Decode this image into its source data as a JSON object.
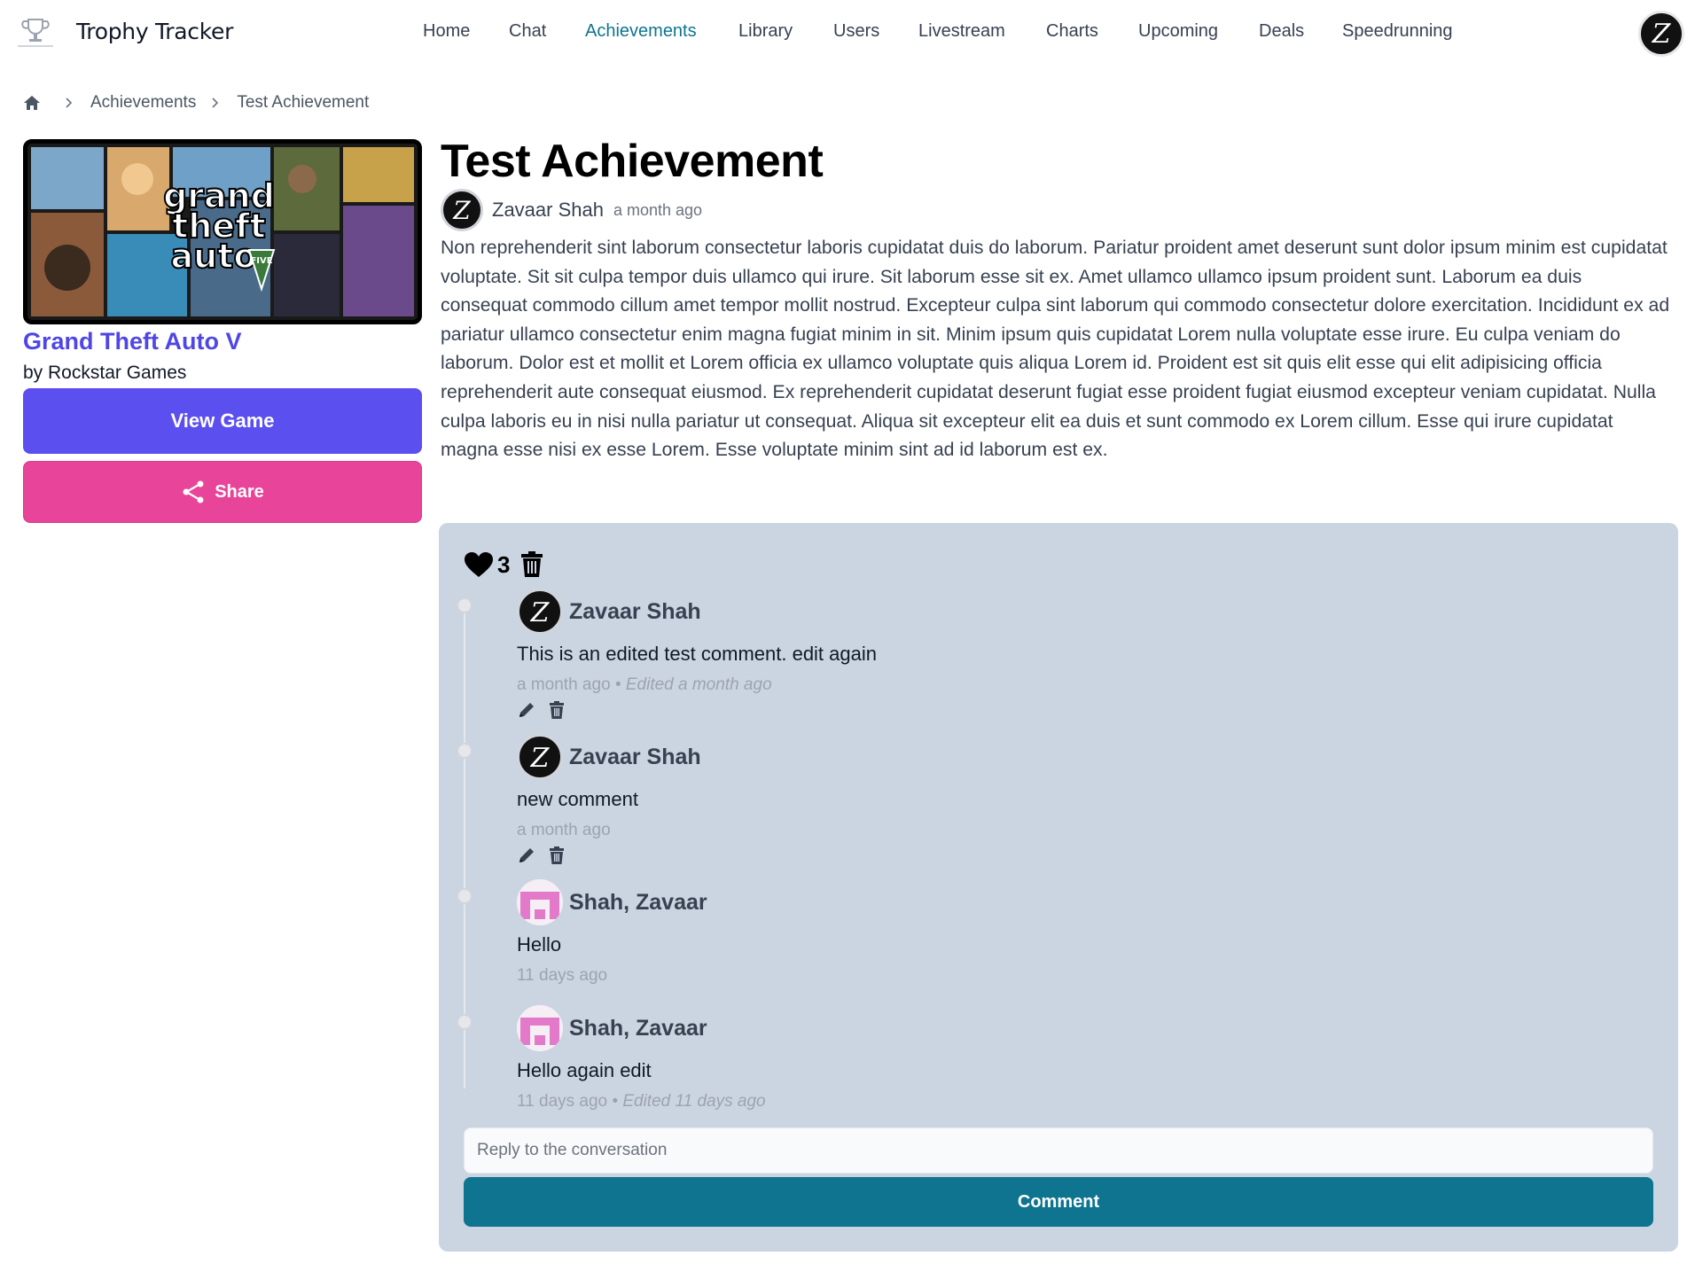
{
  "brand": {
    "name": "Trophy Tracker",
    "logo_icon": "trophy-tracker-logo-icon"
  },
  "nav": {
    "items": [
      {
        "label": "Home",
        "active": false
      },
      {
        "label": "Chat",
        "active": false
      },
      {
        "label": "Achievements",
        "active": true
      },
      {
        "label": "Library",
        "active": false
      },
      {
        "label": "Users",
        "active": false
      },
      {
        "label": "Livestream",
        "active": false
      },
      {
        "label": "Charts",
        "active": false
      },
      {
        "label": "Upcoming",
        "active": false
      },
      {
        "label": "Deals",
        "active": false
      },
      {
        "label": "Speedrunning",
        "active": false
      }
    ],
    "avatar_letter": "Z"
  },
  "breadcrumb": {
    "home_icon": "home-icon",
    "items": [
      "Achievements",
      "Test Achievement"
    ]
  },
  "game": {
    "cover_overlay_text": "grand theft auto",
    "cover_badge_text": "FIVE",
    "title": "Grand Theft Auto V",
    "developer": "by Rockstar Games",
    "view_label": "View Game",
    "share_label": "Share"
  },
  "achievement": {
    "title": "Test Achievement",
    "author": "Zavaar Shah",
    "author_avatar_letter": "Z",
    "posted": "a month ago",
    "description": "Non reprehenderit sint laborum consectetur laboris cupidatat duis do laborum. Pariatur proident amet deserunt sunt dolor ipsum minim est cupidatat voluptate. Sit sit culpa tempor duis ullamco qui irure. Sit laborum esse sit ex. Amet ullamco ullamco ipsum proident sunt. Laborum ea duis consequat commodo cillum amet tempor mollit nostrud. Excepteur culpa sint laborum qui commodo consectetur dolore exercitation. Incididunt ex ad pariatur ullamco consectetur enim magna fugiat minim in sit. Minim ipsum quis cupidatat Lorem nulla voluptate esse irure. Eu culpa veniam do laborum. Dolor est et mollit et Lorem officia ex ullamco voluptate quis aliqua Lorem id. Proident est sit quis elit esse qui elit adipisicing officia reprehenderit aute consequat eiusmod. Ex reprehenderit cupidatat deserunt fugiat esse proident fugiat eiusmod excepteur veniam cupidatat. Nulla culpa laboris eu in nisi nulla pariatur ut consequat. Aliqua sit excepteur elit ea duis et sunt commodo ex Lorem cillum. Esse qui irure cupidatat magna esse nisi ex esse Lorem. Esse voluptate minim sint ad id laborum est ex."
  },
  "reactions": {
    "like_count": "3",
    "like_icon": "heart-icon",
    "delete_icon": "trash-icon"
  },
  "comments": [
    {
      "author": "Zavaar Shah",
      "avatar": "letter-Z",
      "text": "This is an edited test comment. edit again",
      "time": "a month ago",
      "edited": "• Edited a month ago",
      "editable": true
    },
    {
      "author": "Zavaar Shah",
      "avatar": "letter-Z",
      "text": "new comment",
      "time": "a month ago",
      "edited": "",
      "editable": true
    },
    {
      "author": "Shah, Zavaar",
      "avatar": "pink-identicon",
      "text": "Hello",
      "time": "11 days ago",
      "edited": "",
      "editable": false
    },
    {
      "author": "Shah, Zavaar",
      "avatar": "pink-identicon",
      "text": "Hello again edit",
      "time": "11 days ago",
      "edited": "• Edited 11 days ago",
      "editable": false
    }
  ],
  "reply": {
    "placeholder": "Reply to the conversation",
    "value": "",
    "submit_label": "Comment"
  },
  "colors": {
    "accent_nav": "#0e7490",
    "view_button": "#5b4ff0",
    "share_button": "#e8449a",
    "game_title": "#4f46e5",
    "panel_bg": "#cbd5e1",
    "comment_button": "#0e7490"
  }
}
